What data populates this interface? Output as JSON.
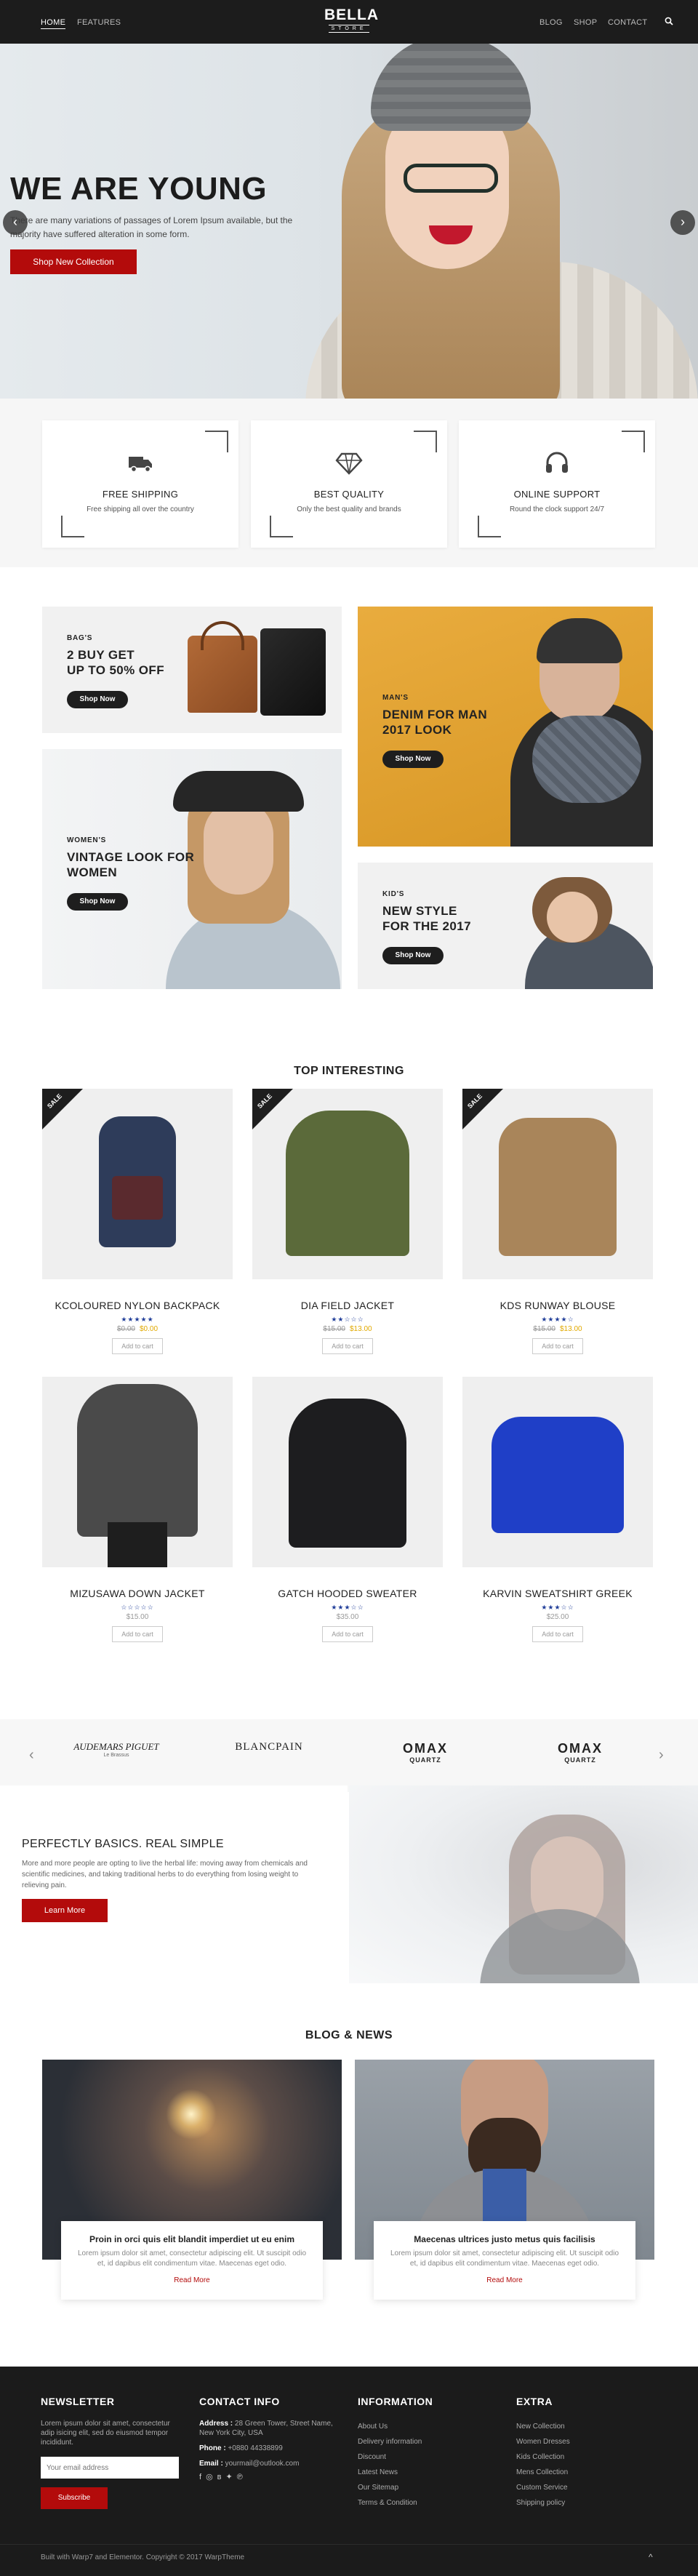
{
  "header": {
    "nav_left": [
      "HOME",
      "FEATURES"
    ],
    "logo_main": "BELLA",
    "logo_sub": "STORE",
    "nav_right": [
      "BLOG",
      "SHOP",
      "CONTACT"
    ],
    "search_icon": "search-icon"
  },
  "hero": {
    "title": "WE ARE YOUNG",
    "text": "There are many variations of passages of Lorem Ipsum available, but the majority have suffered alteration in some form.",
    "button": "Shop New Collection",
    "prev": "‹",
    "next": "›"
  },
  "features": [
    {
      "title": "FREE SHIPPING",
      "text": "Free shipping all over the country",
      "icon": "truck-icon"
    },
    {
      "title": "BEST QUALITY",
      "text": "Only the best quality and brands",
      "icon": "diamond-icon"
    },
    {
      "title": "ONLINE SUPPORT",
      "text": "Round the clock support 24/7",
      "icon": "headphones-icon"
    }
  ],
  "banners": {
    "bags": {
      "sub": "BAG'S",
      "title": "2 BUY GET\nUP TO 50% OFF",
      "button": "Shop Now"
    },
    "man": {
      "sub": "MAN'S",
      "title": "DENIM FOR MAN\n2017 LOOK",
      "button": "Shop Now"
    },
    "women": {
      "sub": "WOMEN'S",
      "title": "VINTAGE LOOK FOR\nWOMEN",
      "button": "Shop Now"
    },
    "kids": {
      "sub": "KID'S",
      "title": "NEW STYLE\nFOR THE 2017",
      "button": "Shop Now"
    }
  },
  "top_interesting": {
    "title": "TOP INTERESTING",
    "sale_label": "SALE",
    "add_to_cart": "Add to cart",
    "products": [
      {
        "name": "KCOLOURED NYLON BACKPACK",
        "old_price": "$0.00",
        "price": "$0.00",
        "rating": 5,
        "sale": true
      },
      {
        "name": "DIA FIELD JACKET",
        "old_price": "$15.00",
        "price": "$13.00",
        "rating": 2,
        "sale": true
      },
      {
        "name": "KDS RUNWAY BLOUSE",
        "old_price": "$15.00",
        "price": "$13.00",
        "rating": 4,
        "sale": true
      },
      {
        "name": "MIZUSAWA DOWN JACKET",
        "old_price": "",
        "price": "$15.00",
        "rating": 0,
        "sale": false
      },
      {
        "name": "GATCH HOODED SWEATER",
        "old_price": "",
        "price": "$35.00",
        "rating": 3,
        "sale": false
      },
      {
        "name": "KARVIN SWEATSHIRT GREEK",
        "old_price": "",
        "price": "$25.00",
        "rating": 3,
        "sale": false
      }
    ]
  },
  "brands": {
    "items": [
      "AUDEMARS PIGUET",
      "BLANCPAIN",
      "OMAX",
      "OMAX"
    ],
    "sub": [
      "Le Brassus",
      "",
      "QUARTZ",
      "QUARTZ"
    ],
    "prev": "‹",
    "next": "›"
  },
  "about": {
    "title": "PERFECTLY BASICS. REAL SIMPLE",
    "text": "More and more people are opting to live the herbal life: moving away from chemicals and scientific medicines, and taking traditional herbs to do everything from losing weight to relieving pain.",
    "button": "Learn More"
  },
  "blog": {
    "title": "BLOG & NEWS",
    "posts": [
      {
        "title": "Proin in orci quis elit blandit imperdiet ut eu enim",
        "excerpt": "Lorem ipsum dolor sit amet, consectetur adipiscing elit. Ut suscipit odio et, id dapibus elit condimentum vitae. Maecenas eget odio.",
        "read_more": "Read More"
      },
      {
        "title": "Maecenas ultrices justo metus quis facilisis",
        "excerpt": "Lorem ipsum dolor sit amet, consectetur adipiscing elit. Ut suscipit odio et, id dapibus elit condimentum vitae. Maecenas eget odio.",
        "read_more": "Read More"
      }
    ]
  },
  "footer": {
    "newsletter": {
      "title": "NEWSLETTER",
      "text": "Lorem ipsum dolor sit amet, consectetur adip isicing elit, sed do eiusmod tempor incididunt.",
      "placeholder": "Your email address",
      "button": "Subscribe"
    },
    "contact": {
      "title": "CONTACT INFO",
      "address_label": "Address :",
      "address": "28 Green Tower, Street Name, New York City, USA",
      "phone_label": "Phone :",
      "phone": "+0880 44338899",
      "email_label": "Email :",
      "email": "yourmail@outlook.com"
    },
    "information": {
      "title": "INFORMATION",
      "links": [
        "About Us",
        "Delivery information",
        "Discount",
        "Latest News",
        "Our Sitemap",
        "Terms & Condition"
      ]
    },
    "extra": {
      "title": "EXTRA",
      "links": [
        "New Collection",
        "Women Dresses",
        "Kids Collection",
        "Mens Collection",
        "Custom Service",
        "Shipping policy"
      ]
    },
    "copyright": "Built with Warp7 and Elementor. Copyright © 2017 WarpTheme",
    "to_top": "^"
  },
  "colors": {
    "accent": "#b30b0b",
    "dark": "#1c1c1c",
    "star": "#23409a",
    "price": "#e1a900"
  }
}
